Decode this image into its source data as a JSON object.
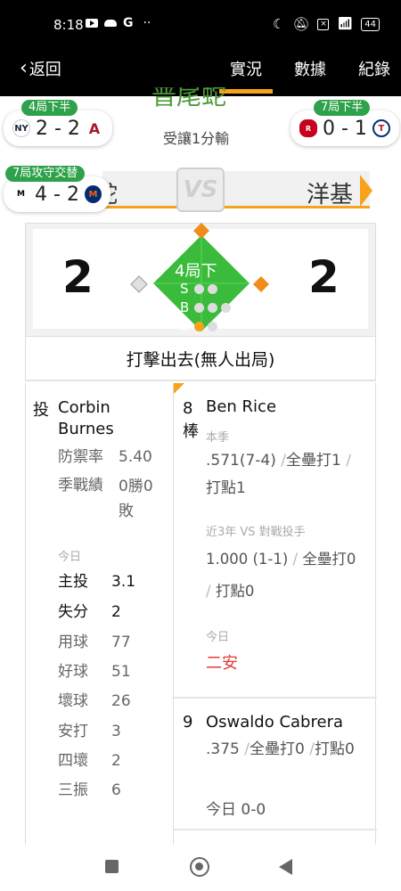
{
  "status_bar": {
    "time": "8:18",
    "left_icons": [
      "youtube-icon",
      "cloud-icon",
      "google-icon",
      "more-dots-icon"
    ],
    "g_letter": "G",
    "dots": "··",
    "battery": "44"
  },
  "header": {
    "back_label": "返回",
    "tabs": [
      {
        "label": "實況",
        "active": true
      },
      {
        "label": "數據",
        "active": false
      },
      {
        "label": "紀錄",
        "active": false
      }
    ]
  },
  "banner": {
    "team_faded": "普尾蛇",
    "handicap_text": "受讓1分輸",
    "left_team_partial": "蛇",
    "right_team": "洋基",
    "vs_text": "VS"
  },
  "mini_scores": [
    {
      "tag": "4局下半",
      "score": "2 - 2",
      "left_logo": "yankees-logo",
      "right_logo": "diamondbacks-logo"
    },
    {
      "tag": "7局下半",
      "score": "0 - 1",
      "left_logo": "reds-logo",
      "right_logo": "rangers-logo"
    },
    {
      "tag": "7局攻守交替",
      "score": "4 - 2",
      "left_logo": "marlins-logo",
      "right_logo": "mets-logo"
    }
  ],
  "scoreboard": {
    "away_score": "2",
    "home_score": "2",
    "inning": "4局下",
    "s_label": "S",
    "b_label": "B",
    "o_label": "O",
    "strikes": 0,
    "balls": 0,
    "outs": 0,
    "bases": {
      "first": true,
      "second": true,
      "third": false
    }
  },
  "play_text": "打擊出去(無人出局)",
  "pitcher": {
    "role": "投",
    "name": "Corbin Burnes",
    "era_label": "防禦率",
    "era": "5.40",
    "record_label": "季戰績",
    "record": "0勝0敗",
    "today_label": "今日",
    "today": [
      {
        "k": "主投",
        "v": "3.1"
      },
      {
        "k": "失分",
        "v": "2"
      },
      {
        "k": "用球",
        "v": "77"
      },
      {
        "k": "好球",
        "v": "51"
      },
      {
        "k": "壞球",
        "v": "26"
      },
      {
        "k": "安打",
        "v": "3"
      },
      {
        "k": "四壞",
        "v": "2"
      },
      {
        "k": "三振",
        "v": "6"
      }
    ]
  },
  "batter": {
    "order": "8",
    "order_label": "棒",
    "name": "Ben Rice",
    "season_label": "本季",
    "season_avg": ".571(7-4)",
    "season_hr": "全壘打1",
    "season_rbi": "打點1",
    "vs_label": "近3年 VS 對戰投手",
    "vs_avg": "1.000 (1-1)",
    "vs_hr": "全壘打0",
    "vs_rbi": "打點0",
    "today_label": "今日",
    "today_result": "二安"
  },
  "next_batter": {
    "order": "9",
    "name": "Oswaldo Cabrera",
    "avg": ".375",
    "hr": "全壘打0",
    "rbi": "打點0",
    "today": "今日 0-0"
  }
}
